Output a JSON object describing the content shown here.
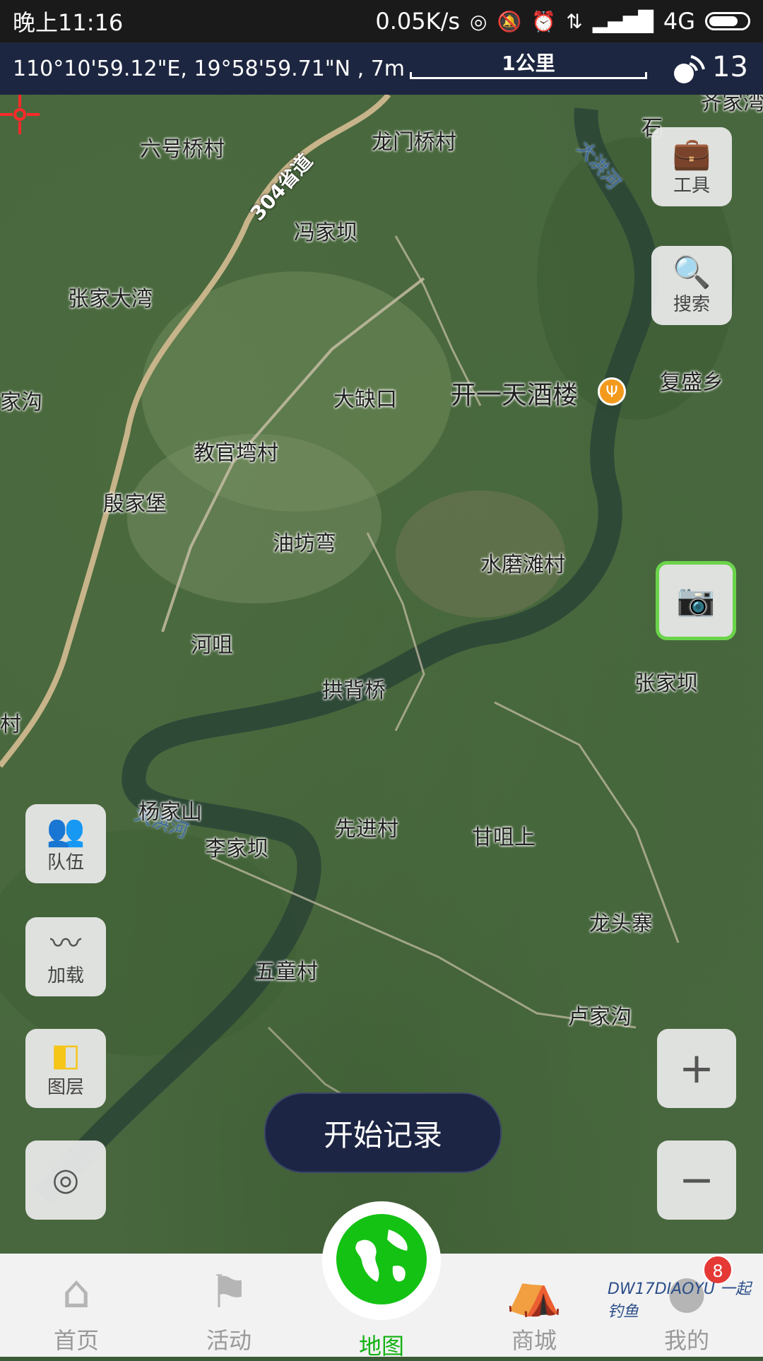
{
  "status_bar": {
    "time": "晚上11:16",
    "speed": "0.05K/s",
    "network": "4G"
  },
  "info_bar": {
    "coordinates": "110°10'59.12\"E, 19°58'59.71\"N , 7m",
    "scale_label": "1公里",
    "satellite_count": "13"
  },
  "map": {
    "places": [
      {
        "name": "六号桥村"
      },
      {
        "name": "龙门桥村"
      },
      {
        "name": "冯家坝"
      },
      {
        "name": "张家大湾"
      },
      {
        "name": "大缺口"
      },
      {
        "name": "开一天酒楼"
      },
      {
        "name": "复盛乡"
      },
      {
        "name": "教官塆村"
      },
      {
        "name": "殷家堡"
      },
      {
        "name": "油坊弯"
      },
      {
        "name": "水磨滩村"
      },
      {
        "name": "河咀"
      },
      {
        "name": "拱背桥"
      },
      {
        "name": "张家坝"
      },
      {
        "name": "杨家山"
      },
      {
        "name": "先进村"
      },
      {
        "name": "李家坝"
      },
      {
        "name": "甘咀上"
      },
      {
        "name": "龙头寨"
      },
      {
        "name": "五童村"
      },
      {
        "name": "卢家沟"
      },
      {
        "name": "齐家湾"
      },
      {
        "name": "石"
      },
      {
        "name": "家沟"
      },
      {
        "name": "村"
      }
    ],
    "river_labels": [
      "大洪河",
      "大洪河"
    ],
    "road_label": "304省道"
  },
  "tools": {
    "tool_label": "工具",
    "search_label": "搜索",
    "team_label": "队伍",
    "load_label": "加载",
    "layer_label": "图层"
  },
  "record": {
    "start_label": "开始记录"
  },
  "bottom_nav": {
    "items": [
      {
        "label": "首页",
        "icon": "home-icon"
      },
      {
        "label": "活动",
        "icon": "flag-icon"
      },
      {
        "label": "地图",
        "icon": "globe-icon"
      },
      {
        "label": "商城",
        "icon": "store-icon"
      },
      {
        "label": "我的",
        "icon": "user-icon"
      }
    ],
    "badge_count": "8"
  },
  "watermark": "DW17DIAOYU 一起钓鱼",
  "colors": {
    "accent_green": "#14c214",
    "info_bar_bg": "#1d2640",
    "poi_orange": "#f39a1c",
    "badge_red": "#e53935"
  }
}
